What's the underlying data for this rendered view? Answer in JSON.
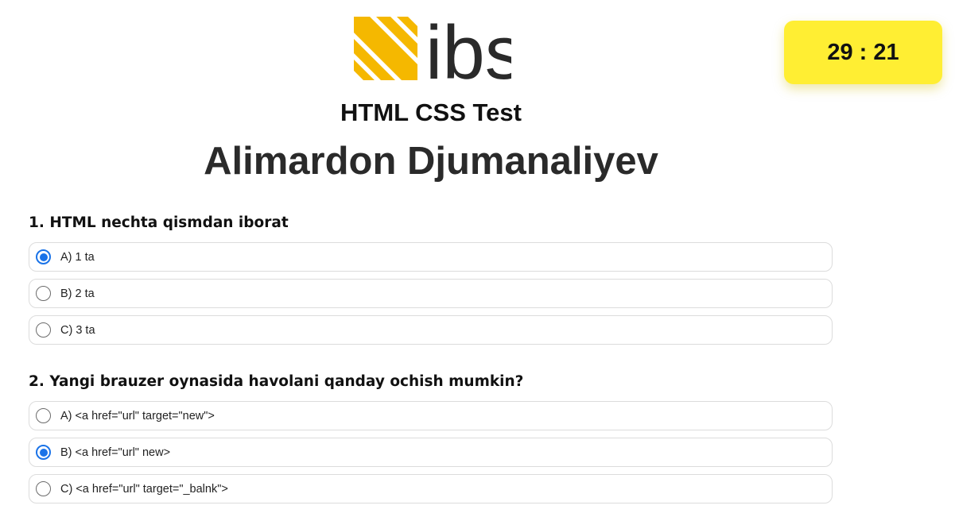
{
  "header": {
    "logo_text": "ibs",
    "test_title": "HTML CSS Test",
    "student_name": "Alimardon Djumanaliyev"
  },
  "timer": {
    "display": "29 : 21"
  },
  "colors": {
    "logo_yellow": "#f5b800",
    "logo_text": "#2a2a2a",
    "timer_bg": "#ffee33",
    "radio_selected": "#1a73e8"
  },
  "questions": [
    {
      "text": "1. HTML nechta qismdan iborat",
      "options": [
        {
          "label": "A) 1 ta",
          "selected": true
        },
        {
          "label": "B) 2 ta",
          "selected": false
        },
        {
          "label": "C) 3 ta",
          "selected": false
        }
      ]
    },
    {
      "text": "2. Yangi brauzer oynasida havolani qanday ochish mumkin?",
      "options": [
        {
          "label": "A) <a href=\"url\" target=\"new\">",
          "selected": false
        },
        {
          "label": "B) <a href=\"url\" new>",
          "selected": true
        },
        {
          "label": "C) <a href=\"url\" target=\"_balnk\">",
          "selected": false
        }
      ]
    }
  ]
}
